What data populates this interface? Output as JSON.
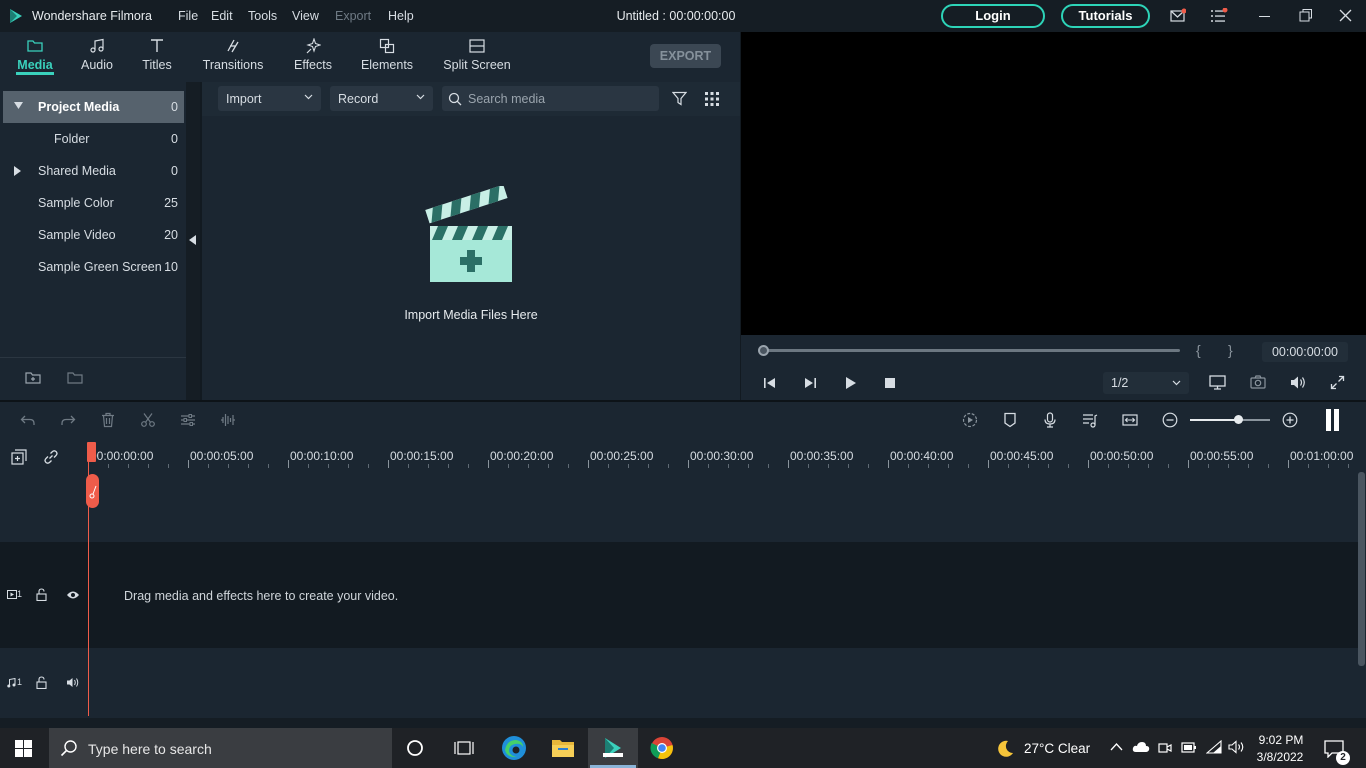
{
  "titlebar": {
    "app_name": "Wondershare Filmora",
    "menu": [
      "File",
      "Edit",
      "Tools",
      "View",
      "Export",
      "Help"
    ],
    "doc_title": "Untitled : 00:00:00:00",
    "login_label": "Login",
    "tutorials_label": "Tutorials",
    "accent": "#2dd4b8"
  },
  "tabs": [
    {
      "label": "Media",
      "icon": "media-folder-icon",
      "active": true
    },
    {
      "label": "Audio",
      "icon": "music-note-icon"
    },
    {
      "label": "Titles",
      "icon": "text-t-icon"
    },
    {
      "label": "Transitions",
      "icon": "transition-icon"
    },
    {
      "label": "Effects",
      "icon": "effects-sparkle-icon"
    },
    {
      "label": "Elements",
      "icon": "elements-icon"
    },
    {
      "label": "Split Screen",
      "icon": "split-screen-icon"
    }
  ],
  "export_label": "EXPORT",
  "library": {
    "items": [
      {
        "name": "Project Media",
        "count": "0",
        "expanded": true,
        "selected": true
      },
      {
        "name": "Folder",
        "count": "0"
      },
      {
        "name": "Shared Media",
        "count": "0",
        "collapsed": true
      },
      {
        "name": "Sample Color",
        "count": "25"
      },
      {
        "name": "Sample Video",
        "count": "20"
      },
      {
        "name": "Sample Green Screen",
        "count": "10"
      }
    ]
  },
  "media_toolbar": {
    "import_label": "Import",
    "record_label": "Record",
    "search_placeholder": "Search media"
  },
  "import_hint": "Import Media Files Here",
  "preview": {
    "time": "00:00:00:00",
    "quality": "1/2",
    "brace_open": "{",
    "brace_close": "}"
  },
  "ruler": {
    "labels": [
      "00:00:00:00",
      "00:00:05:00",
      "00:00:10:00",
      "00:00:15:00",
      "00:00:20:00",
      "00:00:25:00",
      "00:00:30:00",
      "00:00:35:00",
      "00:00:40:00",
      "00:00:45:00",
      "00:00:50:00",
      "00:00:55:00",
      "00:01:00:00"
    ]
  },
  "tracks": {
    "video_label": "1",
    "audio_label": "1",
    "hint": "Drag media and effects here to create your video."
  },
  "taskbar": {
    "search_placeholder": "Type here to search",
    "weather": "27°C  Clear",
    "time": "9:02 PM",
    "date": "3/8/2022",
    "notifications": "2"
  }
}
